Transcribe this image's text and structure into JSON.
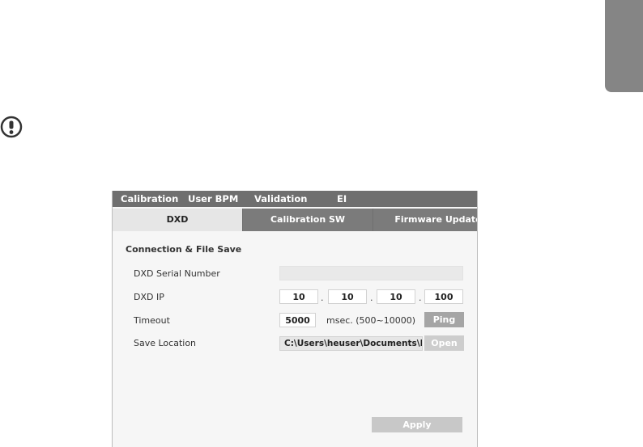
{
  "menubar": {
    "items": [
      {
        "label": "Calibration"
      },
      {
        "label": "User BPM"
      },
      {
        "label": "Validation"
      },
      {
        "label": "EI"
      }
    ]
  },
  "tabs": [
    {
      "label": "DXD",
      "active": true
    },
    {
      "label": "Calibration SW",
      "active": false
    },
    {
      "label": "Firmware Update",
      "active": false
    }
  ],
  "panel": {
    "section_title": "Connection & File Save",
    "serial_label": "DXD Serial Number",
    "serial_value": "",
    "ip_label": "DXD IP",
    "ip": [
      "10",
      "10",
      "10",
      "100"
    ],
    "ip_separator": ".",
    "timeout_label": "Timeout",
    "timeout_value": "5000",
    "timeout_unit": "msec. (500~10000)",
    "ping_label": "Ping",
    "save_label": "Save Location",
    "save_path": "C:\\Users\\heuser\\Documents\\LG",
    "open_label": "Open",
    "apply_label": "Apply"
  },
  "colors": {
    "menubar_bg": "#6f6f6f",
    "tab_inactive": "#7b7b7b",
    "tab_active": "#e6e6e6",
    "side_tab": "#858585"
  }
}
